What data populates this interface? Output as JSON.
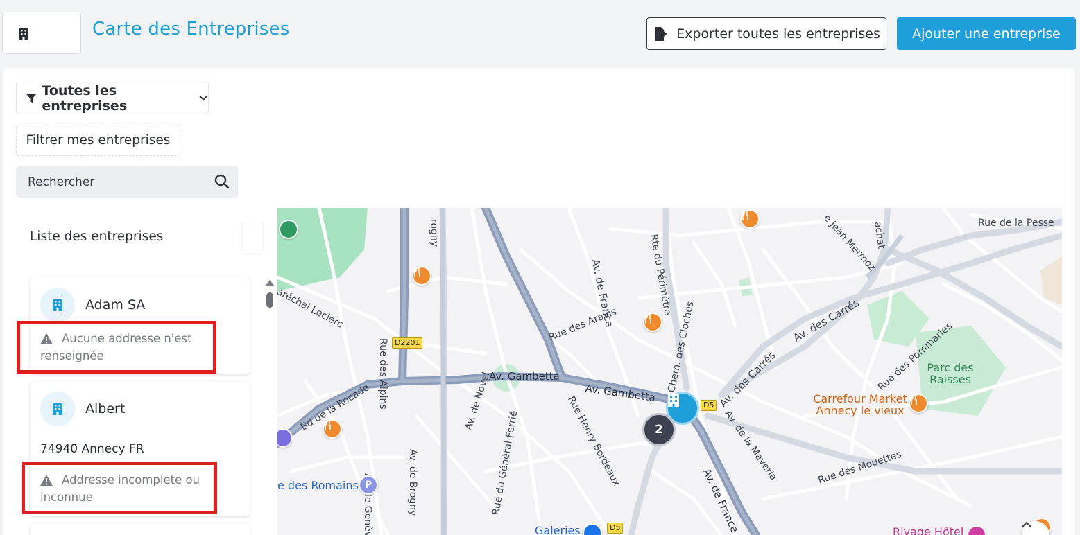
{
  "header": {
    "title": "Carte des Entreprises",
    "export_label": "Exporter toutes les entreprises",
    "add_label": "Ajouter une entreprise",
    "view_toggle": {
      "list_icon": "building-icon",
      "map_icon": "map-icon",
      "active": "map"
    }
  },
  "filters": {
    "dropdown_label": "Toutes les entreprises",
    "mine_label": "Filtrer mes entreprises",
    "search_placeholder": "Rechercher"
  },
  "list": {
    "title": "Liste des entreprises",
    "companies": [
      {
        "name": "Adam SA",
        "address": "",
        "warning": "Aucune addresse n'est renseignée"
      },
      {
        "name": "Albert",
        "address": "74940 Annecy FR",
        "warning": "Addresse incomplete ou inconnue"
      }
    ]
  },
  "map": {
    "streets": [
      "aréchal Leclerc",
      "Bd de la Rocade",
      "Rue des Alpins",
      "Av. de Genève",
      "Av. de Brogny",
      "Av. de Novel",
      "Rue du Général Ferrié",
      "Av. Gambetta",
      "Av. Gambetta",
      "Rue Henry Bordeaux",
      "Av. de France",
      "Av. de France",
      "Rue des Aravis",
      "Rte du Périmètre",
      "Chem. des Cloches",
      "Av. des Carrés",
      "Av. des Carrés",
      "Av. de la Maveria",
      "Rue des Pommaries",
      "Rue des Mouettes",
      "Rue de la Pesse",
      "e Jean Mermoz",
      "achat",
      "rogny"
    ],
    "road_shields": [
      "D2201",
      "D5",
      "D5"
    ],
    "places": {
      "romains": "e des Romains",
      "galeries": "Galeries",
      "carrefour": "Carrefour Market Annecy le vieux",
      "parc": "Parc des Raisses",
      "rivage": "Rivage Hôtel"
    },
    "cluster_count": "2"
  },
  "colors": {
    "accent": "#1e9fd9",
    "warning_box": "#e01e1e",
    "cluster": "#3e4250"
  }
}
